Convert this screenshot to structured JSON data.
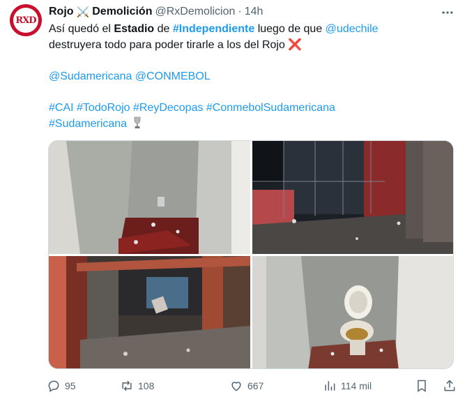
{
  "author": {
    "name": "Rojo",
    "name_suffix": "Demolición",
    "swords_emoji": "⚔️",
    "handle": "@RxDemolicion",
    "separator": "·",
    "time": "14h",
    "avatar_text": "RXD"
  },
  "tweet": {
    "line1": [
      "Así quedó el ",
      "Estadio",
      " de ",
      "#Independiente",
      " luego de que ",
      "@udechile"
    ],
    "line2": "destruyera todo para poder tirarle a los del Rojo",
    "cross_emoji": "❌",
    "mentions": "@Sudamericana @CONMEBOL",
    "hashtags1": "#CAI #TodoRojo #ReyDecopas #ConmebolSudamericana",
    "hashtags2": "#Sudamericana"
  },
  "actions": {
    "replies": "95",
    "reposts": "108",
    "likes": "667",
    "views": "114 mil"
  },
  "icons": {
    "more": "more-horizontal-icon",
    "reply": "reply-icon",
    "repost": "repost-icon",
    "like": "heart-icon",
    "views": "views-icon",
    "bookmark": "bookmark-icon",
    "share": "share-icon"
  },
  "colors": {
    "link": "#1d9bf0",
    "secondary": "#536471",
    "brand": "#c8102e"
  }
}
